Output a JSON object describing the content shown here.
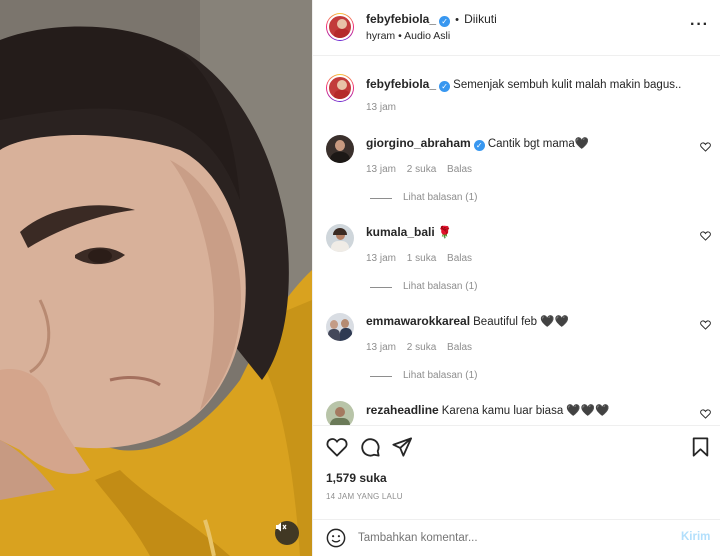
{
  "header": {
    "username": "febyfebiola_",
    "separator": "•",
    "follow_status": "Diikuti",
    "audio": "hyram • Audio Asli",
    "more_icon": "more-horizontal-icon"
  },
  "caption": {
    "username": "febyfebiola_",
    "text": "Semenjak sembuh kulit malah makin bagus..",
    "time": "13 jam"
  },
  "comments": [
    {
      "username": "giorgino_abraham",
      "text": "Cantik bgt mama🖤",
      "time": "13 jam",
      "likes": "2 suka",
      "reply": "Balas",
      "view_replies": "Lihat balasan (1)"
    },
    {
      "username": "kumala_bali",
      "text": "🌹",
      "time": "13 jam",
      "likes": "1 suka",
      "reply": "Balas",
      "view_replies": "Lihat balasan (1)"
    },
    {
      "username": "emmawarokkareal",
      "text": "Beautiful feb 🖤🖤",
      "time": "13 jam",
      "likes": "2 suka",
      "reply": "Balas",
      "view_replies": "Lihat balasan (1)"
    },
    {
      "username": "rezaheadline",
      "text": "Karena kamu luar biasa 🖤🖤🖤"
    }
  ],
  "post": {
    "likes": "1,579 suka",
    "date": "14 JAM YANG LALU"
  },
  "comment_box": {
    "placeholder": "Tambahkan komentar...",
    "submit": "Kirim"
  },
  "colors": {
    "verified": "#3897f0",
    "muted_text": "#8e8e8e",
    "submit_disabled": "#b2dffc",
    "hoodie": "#d9a21f"
  }
}
